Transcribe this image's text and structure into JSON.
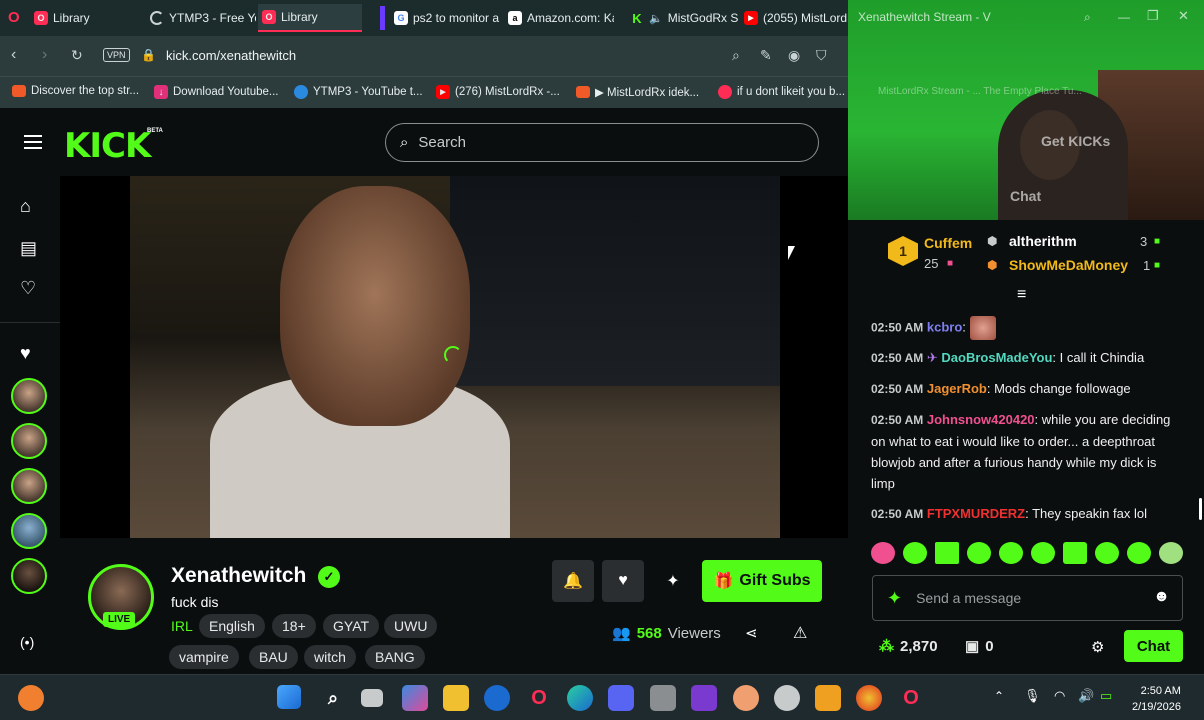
{
  "browser": {
    "tabs": [
      {
        "title": "Library",
        "icon": "opera-icon",
        "active": false
      },
      {
        "title": "YTMP3 - Free Yo",
        "icon": "spinner-icon",
        "active": false
      },
      {
        "title": "Library",
        "icon": "opera-icon",
        "active": true
      },
      {
        "title": "ps2 to monitor a",
        "icon": "google-icon",
        "active": false
      },
      {
        "title": "Amazon.com: Ka",
        "icon": "amazon-icon",
        "active": false
      },
      {
        "title": "MistGodRx St",
        "icon": "kick-icon",
        "active": false
      },
      {
        "title": "(2055) MistLordR",
        "icon": "youtube-icon",
        "active": false
      }
    ],
    "vpn_label": "VPN",
    "url": "kick.com/xenathewitch",
    "bookmarks": [
      {
        "label": "Discover the top str...",
        "icon": "twitch-icon"
      },
      {
        "label": "Download Youtube...",
        "icon": "download-icon"
      },
      {
        "label": "YTMP3 - YouTube t...",
        "icon": "ytmp3-icon"
      },
      {
        "label": "(276) MistLordRx -...",
        "icon": "youtube-icon"
      },
      {
        "label": "▶ MistLordRx idek...",
        "icon": "twitch-icon"
      },
      {
        "label": "if u dont likeit you b...",
        "icon": "opera-icon"
      }
    ]
  },
  "kick": {
    "logo": "KICK",
    "beta": "BETA",
    "search_placeholder": "Search"
  },
  "streamer": {
    "name": "Xenathewitch",
    "title": "fuck dis",
    "live_label": "LIVE",
    "category": "IRL",
    "tags": [
      "English",
      "18+",
      "GYAT",
      "UWU",
      "vampire",
      "BAU",
      "witch",
      "BANG"
    ],
    "viewers_count": "568",
    "viewers_label": "Viewers",
    "gift_subs_label": "Gift Subs"
  },
  "popup": {
    "title": "Xenathewitch Stream - V",
    "overlay_get_kicks": "Get KICKs",
    "overlay_chat": "Chat",
    "overlay_bookmarks": "MistLordRx Stream - ... The Empty Place Tu..."
  },
  "leaderboard": {
    "rank": "1",
    "first": {
      "name": "Cuffem",
      "count": "25"
    },
    "entries": [
      {
        "name": "altherithm",
        "count": "3",
        "color": "#ffffff"
      },
      {
        "name": "ShowMeDaMoney",
        "count": "1",
        "color": "#f2b91a"
      }
    ]
  },
  "chat": {
    "messages": [
      {
        "time": "02:50 AM",
        "user": "kcbro",
        "color": "#7f7ff0",
        "text": ""
      },
      {
        "time": "02:50 AM",
        "user": "DaoBrosMadeYou",
        "color": "#53d8c0",
        "text": "I call it Chindia"
      },
      {
        "time": "02:50 AM",
        "user": "JagerRob",
        "color": "#f09030",
        "text": "Mods change followage"
      },
      {
        "time": "02:50 AM",
        "user": "Johnsnow420420",
        "color": "#f05090",
        "text": "while you are deciding on what to eat i would like to order... a deepthroat blowjob and after a furious handy while my dick is limp"
      },
      {
        "time": "02:50 AM",
        "user": "FTPXMURDERZ",
        "color": "#f03030",
        "text": "They speakin fax lol"
      }
    ],
    "input_placeholder": "Send a message",
    "points": "2,870",
    "gift_count": "0",
    "chat_button": "Chat"
  },
  "taskbar": {
    "time": "2:50 AM",
    "date": "2/19/2026"
  }
}
